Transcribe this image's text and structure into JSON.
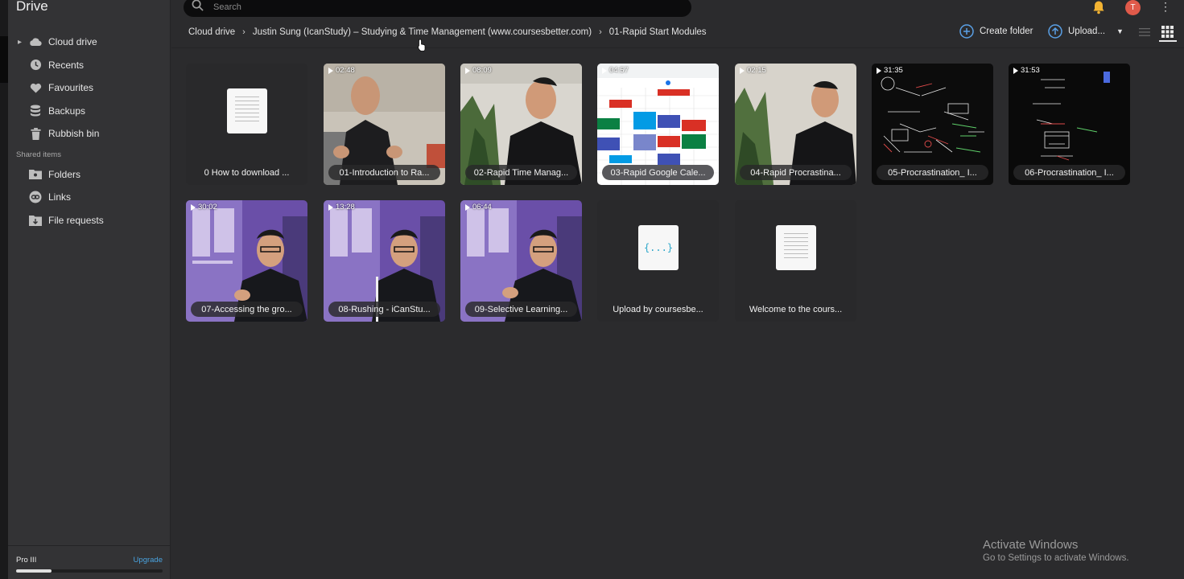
{
  "app": {
    "title": "Drive"
  },
  "sidebar": {
    "items": [
      {
        "label": "Cloud drive",
        "icon": "cloud-icon"
      },
      {
        "label": "Recents",
        "icon": "clock-icon"
      },
      {
        "label": "Favourites",
        "icon": "heart-icon"
      },
      {
        "label": "Backups",
        "icon": "database-icon"
      },
      {
        "label": "Rubbish bin",
        "icon": "trash-icon"
      }
    ],
    "shared_label": "Shared items",
    "shared": [
      {
        "label": "Folders",
        "icon": "shared-folder-icon"
      },
      {
        "label": "Links",
        "icon": "link-icon"
      },
      {
        "label": "File requests",
        "icon": "file-request-icon"
      }
    ],
    "plan": "Pro III",
    "upgrade": "Upgrade",
    "storage_used_fraction": 0.24
  },
  "search": {
    "placeholder": "Search"
  },
  "user": {
    "initial": "T"
  },
  "breadcrumb": [
    "Cloud drive",
    "Justin Sung (IcanStudy) – Studying & Time Management (www.coursesbetter.com)",
    "01-Rapid Start Modules"
  ],
  "toolbar": {
    "create_folder": "Create folder",
    "upload": "Upload..."
  },
  "files": [
    {
      "name": "0 How to download ...",
      "type": "doc"
    },
    {
      "name": "01-Introduction to Ra...",
      "type": "video",
      "duration": "02:48"
    },
    {
      "name": "02-Rapid Time Manag...",
      "type": "video",
      "duration": "08:09"
    },
    {
      "name": "03-Rapid Google Cale...",
      "type": "video",
      "duration": "04:57"
    },
    {
      "name": "04-Rapid Procrastina...",
      "type": "video",
      "duration": "02:15"
    },
    {
      "name": "05-Procrastination_ I...",
      "type": "video",
      "duration": "31:35"
    },
    {
      "name": "06-Procrastination_ I...",
      "type": "video",
      "duration": "31:53"
    },
    {
      "name": "07-Accessing the gro...",
      "type": "video",
      "duration": "30:02"
    },
    {
      "name": "08-Rushing - iCanStu...",
      "type": "video",
      "duration": "13:28"
    },
    {
      "name": "09-Selective Learning...",
      "type": "video",
      "duration": "06:44"
    },
    {
      "name": "Upload by coursesbe...",
      "type": "json"
    },
    {
      "name": "Welcome to the cours...",
      "type": "doc"
    }
  ],
  "json_icon_text": "{...}",
  "watermark": {
    "line1": "Activate Windows",
    "line2": "Go to Settings to activate Windows."
  }
}
